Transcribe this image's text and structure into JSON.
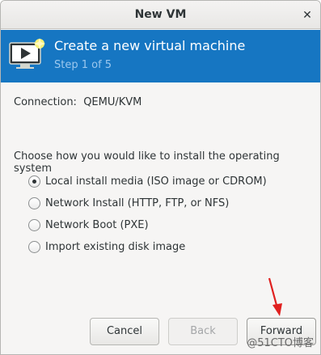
{
  "window": {
    "title": "New VM",
    "close_icon": "close-icon"
  },
  "banner": {
    "title": "Create a new virtual machine",
    "step": "Step 1 of 5",
    "icon": "monitor-play-icon",
    "color": "#1676c2"
  },
  "connection": "Connection:  QEMU/KVM",
  "install": {
    "prompt": "Choose how you would like to install the operating system",
    "options": [
      {
        "label": "Local install media (ISO image or CDROM)",
        "checked": true
      },
      {
        "label": "Network Install (HTTP, FTP, or NFS)",
        "checked": false
      },
      {
        "label": "Network Boot (PXE)",
        "checked": false
      },
      {
        "label": "Import existing disk image",
        "checked": false
      }
    ]
  },
  "buttons": {
    "cancel": "Cancel",
    "back": "Back",
    "forward": "Forward"
  },
  "annotation": {
    "arrow_color": "#e0201f"
  },
  "watermark": "@51CTO博客"
}
